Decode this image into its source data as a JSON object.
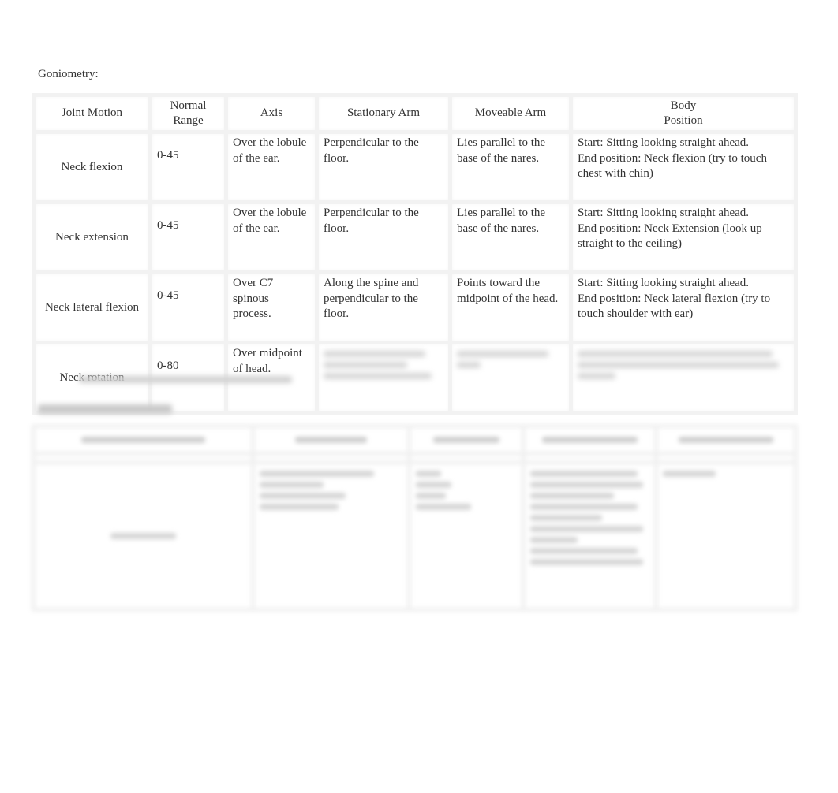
{
  "document": {
    "heading": "Goniometry:",
    "goniometry_table": {
      "headers": [
        "Joint Motion",
        "Normal Range",
        "Axis",
        "Stationary Arm",
        "Moveable Arm",
        "Body Position"
      ],
      "header_lines": {
        "normal_range": [
          "Normal",
          "Range"
        ],
        "body_position": [
          "Body",
          "Position"
        ]
      },
      "rows": [
        {
          "joint_motion": "Neck flexion",
          "normal_range": "0-45",
          "axis": "Over the lobule of the ear.",
          "stationary_arm": "Perpendicular to the floor.",
          "moveable_arm": "Lies parallel to the base of the nares.",
          "body_position_start": "Start: Sitting looking straight ahead.",
          "body_position_end": "End position: Neck flexion (try to touch chest with chin)"
        },
        {
          "joint_motion": "Neck extension",
          "normal_range": "0-45",
          "axis": "Over the lobule of the ear.",
          "stationary_arm": "Perpendicular to the floor.",
          "moveable_arm": "Lies parallel to the base of the nares.",
          "body_position_start": "Start: Sitting looking straight ahead.",
          "body_position_end": "End position: Neck Extension (look up straight to the ceiling)"
        },
        {
          "joint_motion": "Neck lateral flexion",
          "normal_range": "0-45",
          "axis": "Over C7 spinous process.",
          "stationary_arm": "Along the spine and perpendicular to the floor.",
          "moveable_arm": "Points toward the midpoint of the head.",
          "body_position_start": "Start: Sitting looking straight ahead.",
          "body_position_end": "End position: Neck lateral flexion (try to touch shoulder with ear)"
        },
        {
          "joint_motion": "Neck rotation",
          "normal_range": "0-80",
          "axis": "Over midpoint of head.",
          "stationary_arm": "",
          "moveable_arm": "",
          "body_position_start": "",
          "body_position_end": "",
          "blurred_cells": [
            "stationary_arm",
            "moveable_arm",
            "body_position"
          ]
        }
      ]
    },
    "blurred_section": {
      "note": "content below is blurred and unreadable",
      "mmt_table_column_count": 5
    }
  }
}
